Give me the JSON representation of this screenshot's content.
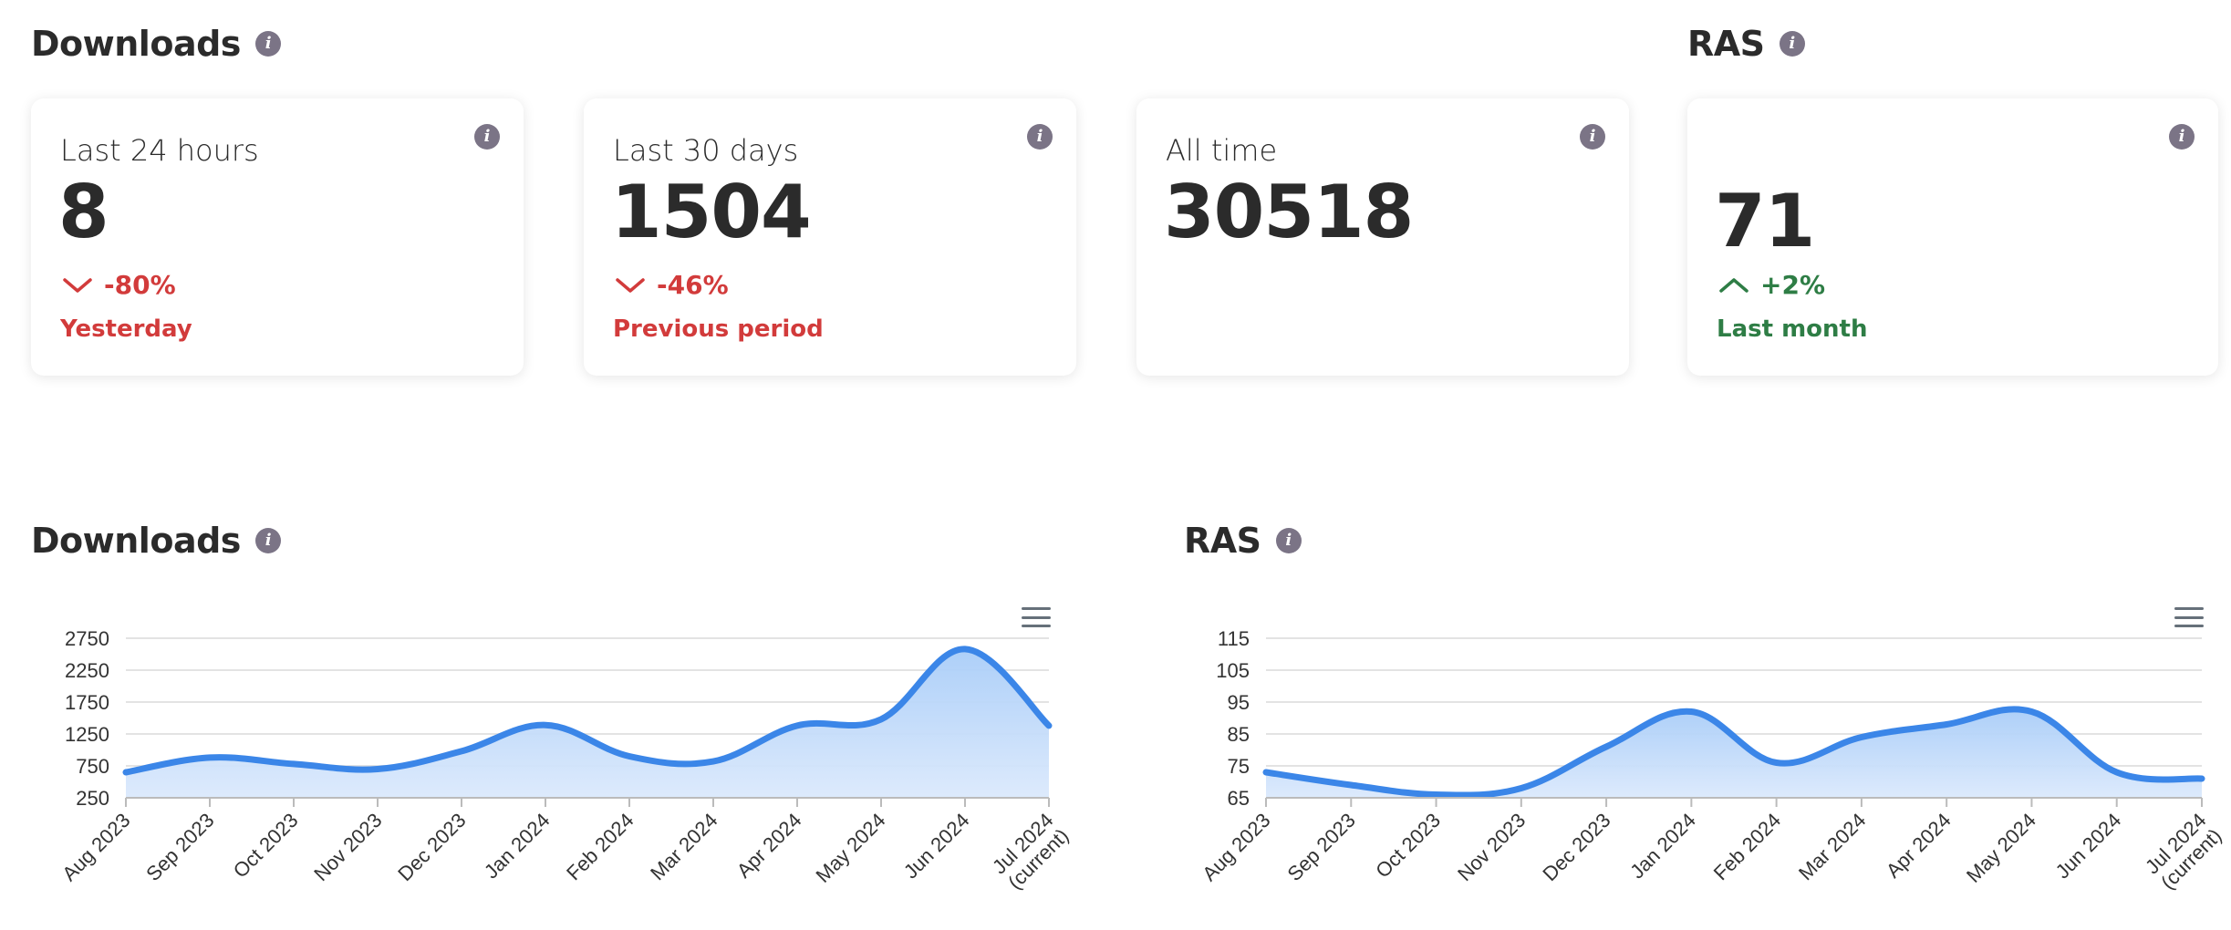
{
  "summary": {
    "downloads_heading": "Downloads",
    "ras_heading": "RAS",
    "cards": [
      {
        "label": "Last 24 hours",
        "value": "8",
        "change": "-80%",
        "direction": "down",
        "compare": "Yesterday"
      },
      {
        "label": "Last 30 days",
        "value": "1504",
        "change": "-46%",
        "direction": "down",
        "compare": "Previous period"
      },
      {
        "label": "All time",
        "value": "30518"
      },
      {
        "label": "",
        "value": "71",
        "change": "+2%",
        "direction": "up",
        "compare": "Last month"
      }
    ]
  },
  "charts": {
    "downloads_heading": "Downloads",
    "ras_heading": "RAS"
  },
  "colors": {
    "negative": "#d23b3b",
    "positive": "#2e7d45",
    "line": "#3b86e8",
    "area": "#cfe2fb"
  },
  "icons": {
    "info": "info-icon",
    "menu": "hamburger-menu-icon",
    "down": "chevron-down-icon",
    "up": "chevron-up-icon"
  },
  "chart_data": [
    {
      "type": "area",
      "x": [
        "Aug 2023",
        "Sep 2023",
        "Oct 2023",
        "Nov 2023",
        "Dec 2023",
        "Jan 2024",
        "Feb 2024",
        "Mar 2024",
        "Apr 2024",
        "May 2024",
        "Jun 2024",
        "Jul 2024 (current)"
      ],
      "series": [
        {
          "values": [
            650,
            880,
            780,
            700,
            980,
            1390,
            900,
            820,
            1380,
            1480,
            2580,
            1380
          ]
        }
      ],
      "yticks": [
        250,
        750,
        1250,
        1750,
        2250,
        2750
      ],
      "ylim": [
        250,
        2950
      ],
      "grid": true,
      "legend": "none"
    },
    {
      "type": "area",
      "x": [
        "Aug 2023",
        "Sep 2023",
        "Oct 2023",
        "Nov 2023",
        "Dec 2023",
        "Jan 2024",
        "Feb 2024",
        "Mar 2024",
        "Apr 2024",
        "May 2024",
        "Jun 2024",
        "Jul 2024 (current)"
      ],
      "series": [
        {
          "values": [
            73,
            69,
            66,
            68,
            81,
            92,
            76,
            84,
            88,
            92,
            73,
            71
          ]
        }
      ],
      "yticks": [
        65,
        75,
        85,
        95,
        105,
        115
      ],
      "ylim": [
        65,
        119
      ],
      "grid": true,
      "legend": "none"
    }
  ]
}
